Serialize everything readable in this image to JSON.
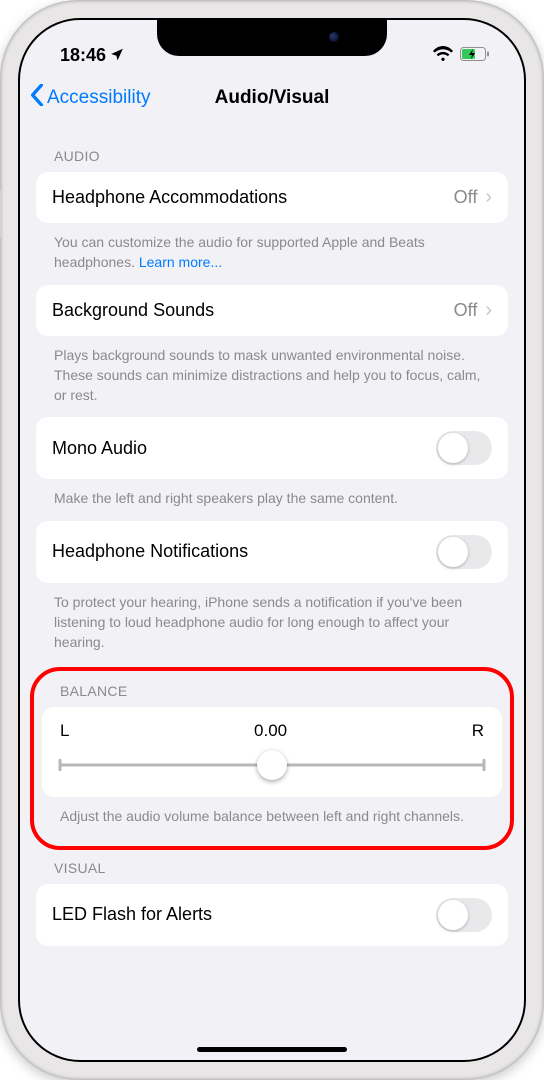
{
  "status": {
    "time": "18:46"
  },
  "nav": {
    "back": "Accessibility",
    "title": "Audio/Visual"
  },
  "sections": {
    "audio_header": "AUDIO",
    "headphone_accom": {
      "label": "Headphone Accommodations",
      "value": "Off"
    },
    "headphone_accom_footer": "You can customize the audio for supported Apple and Beats headphones. ",
    "headphone_accom_link": "Learn more...",
    "background_sounds": {
      "label": "Background Sounds",
      "value": "Off"
    },
    "background_sounds_footer": "Plays background sounds to mask unwanted environmental noise. These sounds can minimize distractions and help you to focus, calm, or rest.",
    "mono_audio": {
      "label": "Mono Audio"
    },
    "mono_audio_footer": "Make the left and right speakers play the same content.",
    "headphone_notif": {
      "label": "Headphone Notifications"
    },
    "headphone_notif_footer": "To protect your hearing, iPhone sends a notification if you've been listening to loud headphone audio for long enough to affect your hearing.",
    "balance_header": "BALANCE",
    "balance": {
      "left": "L",
      "value": "0.00",
      "right": "R"
    },
    "balance_footer": "Adjust the audio volume balance between left and right channels.",
    "visual_header": "VISUAL",
    "led_flash": {
      "label": "LED Flash for Alerts"
    }
  }
}
